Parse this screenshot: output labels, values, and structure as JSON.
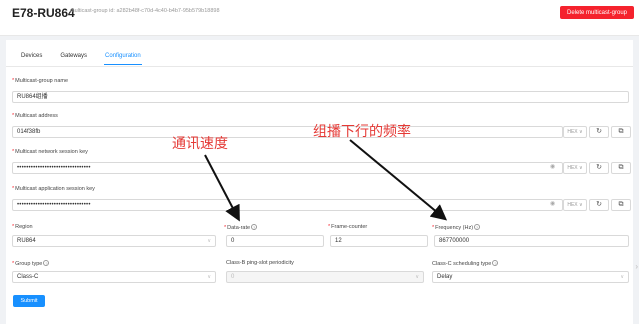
{
  "header": {
    "title": "E78-RU864",
    "subtitle": "multicast-group id: a282b48f-c70d-4c40-b4b7-95b579b18898",
    "delete_button": "Delete multicast-group"
  },
  "tabs": [
    "Devices",
    "Gateways",
    "Configuration"
  ],
  "active_tab": "Configuration",
  "form": {
    "name_label": "Multicast-group name",
    "name_value": "RU864组播",
    "address_label": "Multicast address",
    "address_value": "014f38fb",
    "address_addon": "HEX",
    "nwk_key_label": "Multicast network session key",
    "nwk_key_value": "••••••••••••••••••••••••••••••••",
    "nwk_key_addon": "HEX",
    "app_key_label": "Multicast application session key",
    "app_key_value": "••••••••••••••••••••••••••••••••",
    "app_key_addon": "HEX",
    "region_label": "Region",
    "region_value": "RU864",
    "data_rate_label": "Data-rate",
    "data_rate_value": "0",
    "frame_counter_label": "Frame-counter",
    "frame_counter_value": "12",
    "frequency_label": "Frequency (Hz)",
    "frequency_value": "867700000",
    "group_type_label": "Group type",
    "group_type_value": "Class-C",
    "ping_slot_label": "Class-B ping-slot periodicity",
    "ping_slot_value": "0",
    "class_c_label": "Class-C scheduling type",
    "class_c_value": "Delay",
    "submit": "Submit"
  },
  "annotations": {
    "left": "通讯速度",
    "right": "组播下行的频率"
  },
  "icons": {
    "refresh": "↻",
    "copy": "⧉",
    "eye": "◉",
    "chevron": "∨",
    "question": "?"
  },
  "colors": {
    "primary": "#1890ff",
    "danger": "#f5222d",
    "annotation": "#e53935"
  }
}
